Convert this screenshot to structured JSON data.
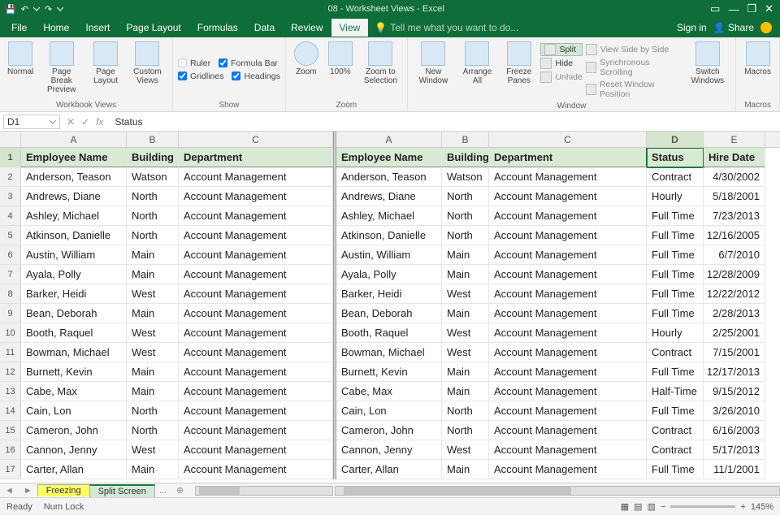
{
  "titlebar": {
    "doc": "08 - Worksheet Views - Excel"
  },
  "account": {
    "signin": "Sign in",
    "share": "Share"
  },
  "menu": {
    "file": "File",
    "home": "Home",
    "insert": "Insert",
    "layout": "Page Layout",
    "formulas": "Formulas",
    "data": "Data",
    "review": "Review",
    "view": "View",
    "tell": "Tell me what you want to do..."
  },
  "ribbon": {
    "wbviews": {
      "normal": "Normal",
      "pagebreak": "Page Break Preview",
      "pagelayout": "Page Layout",
      "custom": "Custom Views",
      "label": "Workbook Views"
    },
    "show": {
      "ruler": "Ruler",
      "formulabar": "Formula Bar",
      "gridlines": "Gridlines",
      "headings": "Headings",
      "label": "Show"
    },
    "zoom": {
      "zoom": "Zoom",
      "z100": "100%",
      "zsel": "Zoom to Selection",
      "label": "Zoom"
    },
    "window": {
      "neww": "New Window",
      "arrange": "Arrange All",
      "freeze": "Freeze Panes",
      "split": "Split",
      "hide": "Hide",
      "unhide": "Unhide",
      "side": "View Side by Side",
      "sync": "Synchronous Scrolling",
      "reset": "Reset Window Position",
      "switch": "Switch Windows",
      "label": "Window"
    },
    "macros": {
      "macros": "Macros",
      "label": "Macros"
    }
  },
  "namebox": "D1",
  "formula": "Status",
  "columns": {
    "left": [
      "A",
      "B",
      "C"
    ],
    "right": [
      "A",
      "B",
      "C",
      "D",
      "E"
    ]
  },
  "headers": {
    "name": "Employee Name",
    "building": "Building",
    "dept": "Department",
    "status": "Status",
    "hire": "Hire Date"
  },
  "rows": [
    {
      "n": "Anderson, Teason",
      "b": "Watson",
      "d": "Account Management",
      "s": "Contract",
      "h": "4/30/2002"
    },
    {
      "n": "Andrews, Diane",
      "b": "North",
      "d": "Account Management",
      "s": "Hourly",
      "h": "5/18/2001"
    },
    {
      "n": "Ashley, Michael",
      "b": "North",
      "d": "Account Management",
      "s": "Full Time",
      "h": "7/23/2013"
    },
    {
      "n": "Atkinson, Danielle",
      "b": "North",
      "d": "Account Management",
      "s": "Full Time",
      "h": "12/16/2005"
    },
    {
      "n": "Austin, William",
      "b": "Main",
      "d": "Account Management",
      "s": "Full Time",
      "h": "6/7/2010"
    },
    {
      "n": "Ayala, Polly",
      "b": "Main",
      "d": "Account Management",
      "s": "Full Time",
      "h": "12/28/2009"
    },
    {
      "n": "Barker, Heidi",
      "b": "West",
      "d": "Account Management",
      "s": "Full Time",
      "h": "12/22/2012"
    },
    {
      "n": "Bean, Deborah",
      "b": "Main",
      "d": "Account Management",
      "s": "Full Time",
      "h": "2/28/2013"
    },
    {
      "n": "Booth, Raquel",
      "b": "West",
      "d": "Account Management",
      "s": "Hourly",
      "h": "2/25/2001"
    },
    {
      "n": "Bowman, Michael",
      "b": "West",
      "d": "Account Management",
      "s": "Contract",
      "h": "7/15/2001"
    },
    {
      "n": "Burnett, Kevin",
      "b": "Main",
      "d": "Account Management",
      "s": "Full Time",
      "h": "12/17/2013"
    },
    {
      "n": "Cabe, Max",
      "b": "Main",
      "d": "Account Management",
      "s": "Half-Time",
      "h": "9/15/2012"
    },
    {
      "n": "Cain, Lon",
      "b": "North",
      "d": "Account Management",
      "s": "Full Time",
      "h": "3/26/2010"
    },
    {
      "n": "Cameron, John",
      "b": "North",
      "d": "Account Management",
      "s": "Contract",
      "h": "6/16/2003"
    },
    {
      "n": "Cannon, Jenny",
      "b": "West",
      "d": "Account Management",
      "s": "Contract",
      "h": "5/17/2013"
    },
    {
      "n": "Carter, Allan",
      "b": "Main",
      "d": "Account Management",
      "s": "Full Time",
      "h": "11/1/2001"
    }
  ],
  "sheets": {
    "freezing": "Freezing",
    "split": "Split Screen",
    "more": "..."
  },
  "status": {
    "ready": "Ready",
    "numlock": "Num Lock",
    "zoom": "145%"
  }
}
